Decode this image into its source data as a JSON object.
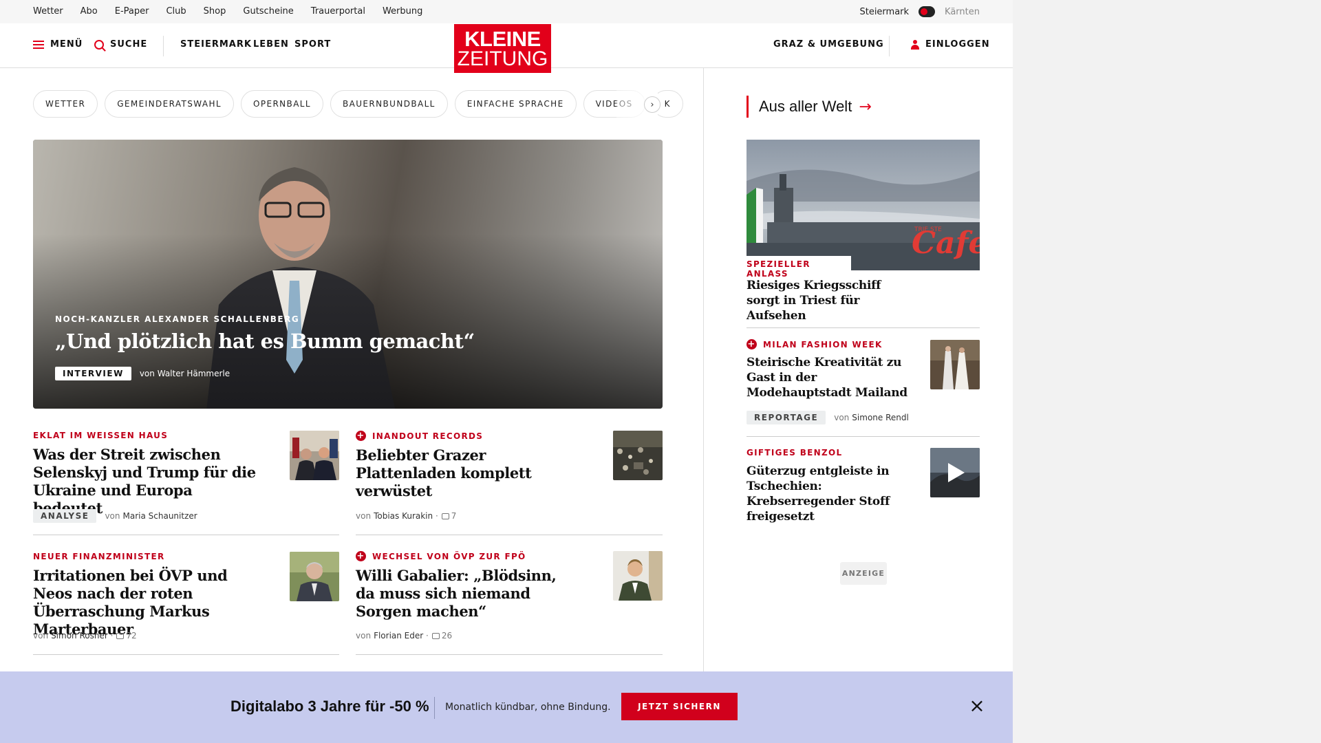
{
  "utility": {
    "links": [
      "Wetter",
      "Abo",
      "E-Paper",
      "Club",
      "Shop",
      "Gutscheine",
      "Trauerportal",
      "Werbung"
    ],
    "region_active": "Steiermark",
    "region_inactive": "Kärnten"
  },
  "nav": {
    "menu": "MENÜ",
    "search": "SUCHE",
    "sections": [
      "STEIERMARK",
      "LEBEN",
      "SPORT"
    ],
    "logo_line1": "KLEINE",
    "logo_line2": "ZEITUNG",
    "region": "GRAZ & UMGEBUNG",
    "login": "EINLOGGEN"
  },
  "chips": [
    "WETTER",
    "GEMEINDERATSWAHL",
    "OPERNBALL",
    "BAUERNBUNDBALL",
    "EINFACHE SPRACHE",
    "VIDEOS",
    "K"
  ],
  "hero": {
    "kicker": "NOCH-KANZLER ALEXANDER SCHALLENBERG",
    "title": "„Und plötzlich hat es Bumm gemacht“",
    "badge": "INTERVIEW",
    "author_prefix": "von",
    "author": "Walter Hämmerle"
  },
  "articles": [
    {
      "kicker": "EKLAT IM WEISSEN HAUS",
      "plus": false,
      "title": "Was der Streit zwischen Selenskyj und Trump für die Ukraine und Europa bedeutet",
      "badge": "ANALYSE",
      "author_prefix": "von",
      "author": "Maria Schaunitzer",
      "comments": ""
    },
    {
      "kicker": "INANDOUT RECORDS",
      "plus": true,
      "title": "Beliebter Grazer Plattenladen komplett verwüstet",
      "badge": "",
      "author_prefix": "von",
      "author": "Tobias Kurakin",
      "comments": "7"
    },
    {
      "kicker": "NEUER FINANZMINISTER",
      "plus": false,
      "title": "Irritationen bei ÖVP und Neos nach der roten Überraschung Markus Marterbauer",
      "badge": "",
      "author_prefix": "von",
      "author": "Simon Rosner",
      "comments": "72"
    },
    {
      "kicker": "WECHSEL VON ÖVP ZUR FPÖ",
      "plus": true,
      "title": "Willi Gabalier: „Blödsinn, da muss sich niemand Sorgen machen“",
      "badge": "",
      "author_prefix": "von",
      "author": "Florian Eder",
      "comments": "26"
    }
  ],
  "sidebar": {
    "section_title": "Aus aller Welt",
    "lead": {
      "kicker": "SPEZIELLER ANLASS",
      "title": "Riesiges Kriegsschiff sorgt in Triest für Aufsehen",
      "image_text": "Cafe",
      "image_small_text": "TRIE STE"
    },
    "items": [
      {
        "kicker": "MILAN FASHION WEEK",
        "plus": true,
        "title": "Steirische Kreativität zu Gast in der Modehauptstadt Mailand",
        "badge": "REPORTAGE",
        "author_prefix": "von",
        "author": "Simone Rendl"
      },
      {
        "kicker": "GIFTIGES BENZOL",
        "plus": false,
        "title": "Güterzug entgleiste in Tschechien: Krebserregender Stoff freigesetzt"
      }
    ],
    "ad_label": "ANZEIGE"
  },
  "promo": {
    "headline": "Digitalabo 3 Jahre für -50 %",
    "sub": "Monatlich kündbar, ohne Bindung.",
    "button": "JETZT SICHERN",
    "close": "×"
  },
  "colors": {
    "brand_red": "#e2001a",
    "kicker_red": "#c0001a",
    "promo_bg": "#c6cbee"
  }
}
